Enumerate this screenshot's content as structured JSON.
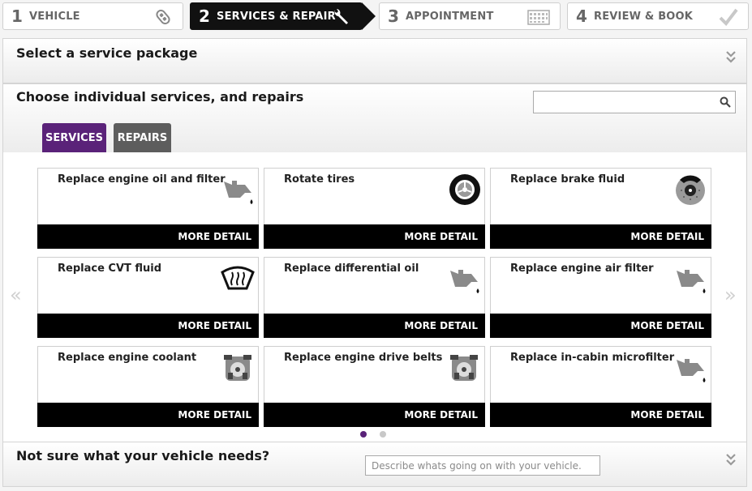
{
  "steps": [
    {
      "num": "1",
      "label": "VEHICLE"
    },
    {
      "num": "2",
      "label": "SERVICES & REPAIR"
    },
    {
      "num": "3",
      "label": "APPOINTMENT"
    },
    {
      "num": "4",
      "label": "REVIEW & BOOK"
    }
  ],
  "package": {
    "title": "Select a service package"
  },
  "individual": {
    "title": "Choose individual services, and repairs",
    "search_placeholder": ""
  },
  "tabs": {
    "services": "SERVICES",
    "repairs": "REPAIRS",
    "active": "services"
  },
  "cards": [
    {
      "title": "Replace engine oil and filter",
      "icon": "oil-can-icon",
      "more": "MORE DETAIL"
    },
    {
      "title": "Rotate tires",
      "icon": "tire-icon",
      "more": "MORE DETAIL"
    },
    {
      "title": "Replace brake fluid",
      "icon": "brake-disc-icon",
      "more": "MORE DETAIL"
    },
    {
      "title": "Replace CVT fluid",
      "icon": "defroster-icon",
      "more": "MORE DETAIL"
    },
    {
      "title": "Replace differential oil",
      "icon": "oil-can-icon",
      "more": "MORE DETAIL"
    },
    {
      "title": "Replace engine air filter",
      "icon": "oil-can-icon",
      "more": "MORE DETAIL"
    },
    {
      "title": "Replace engine coolant",
      "icon": "engine-icon",
      "more": "MORE DETAIL"
    },
    {
      "title": "Replace engine drive belts",
      "icon": "engine-icon",
      "more": "MORE DETAIL"
    },
    {
      "title": "Replace in-cabin microfilter",
      "icon": "oil-can-icon",
      "more": "MORE DETAIL"
    }
  ],
  "pagination": {
    "current": 1,
    "total": 2
  },
  "nav": {
    "prev": "«",
    "next": "»"
  },
  "help": {
    "title": "Not sure what your vehicle needs?",
    "placeholder": "Describe whats going on with your vehicle."
  },
  "colors": {
    "accent": "#5a2279",
    "active_step": "#111111",
    "repairs_tab": "#5d5d5d"
  }
}
